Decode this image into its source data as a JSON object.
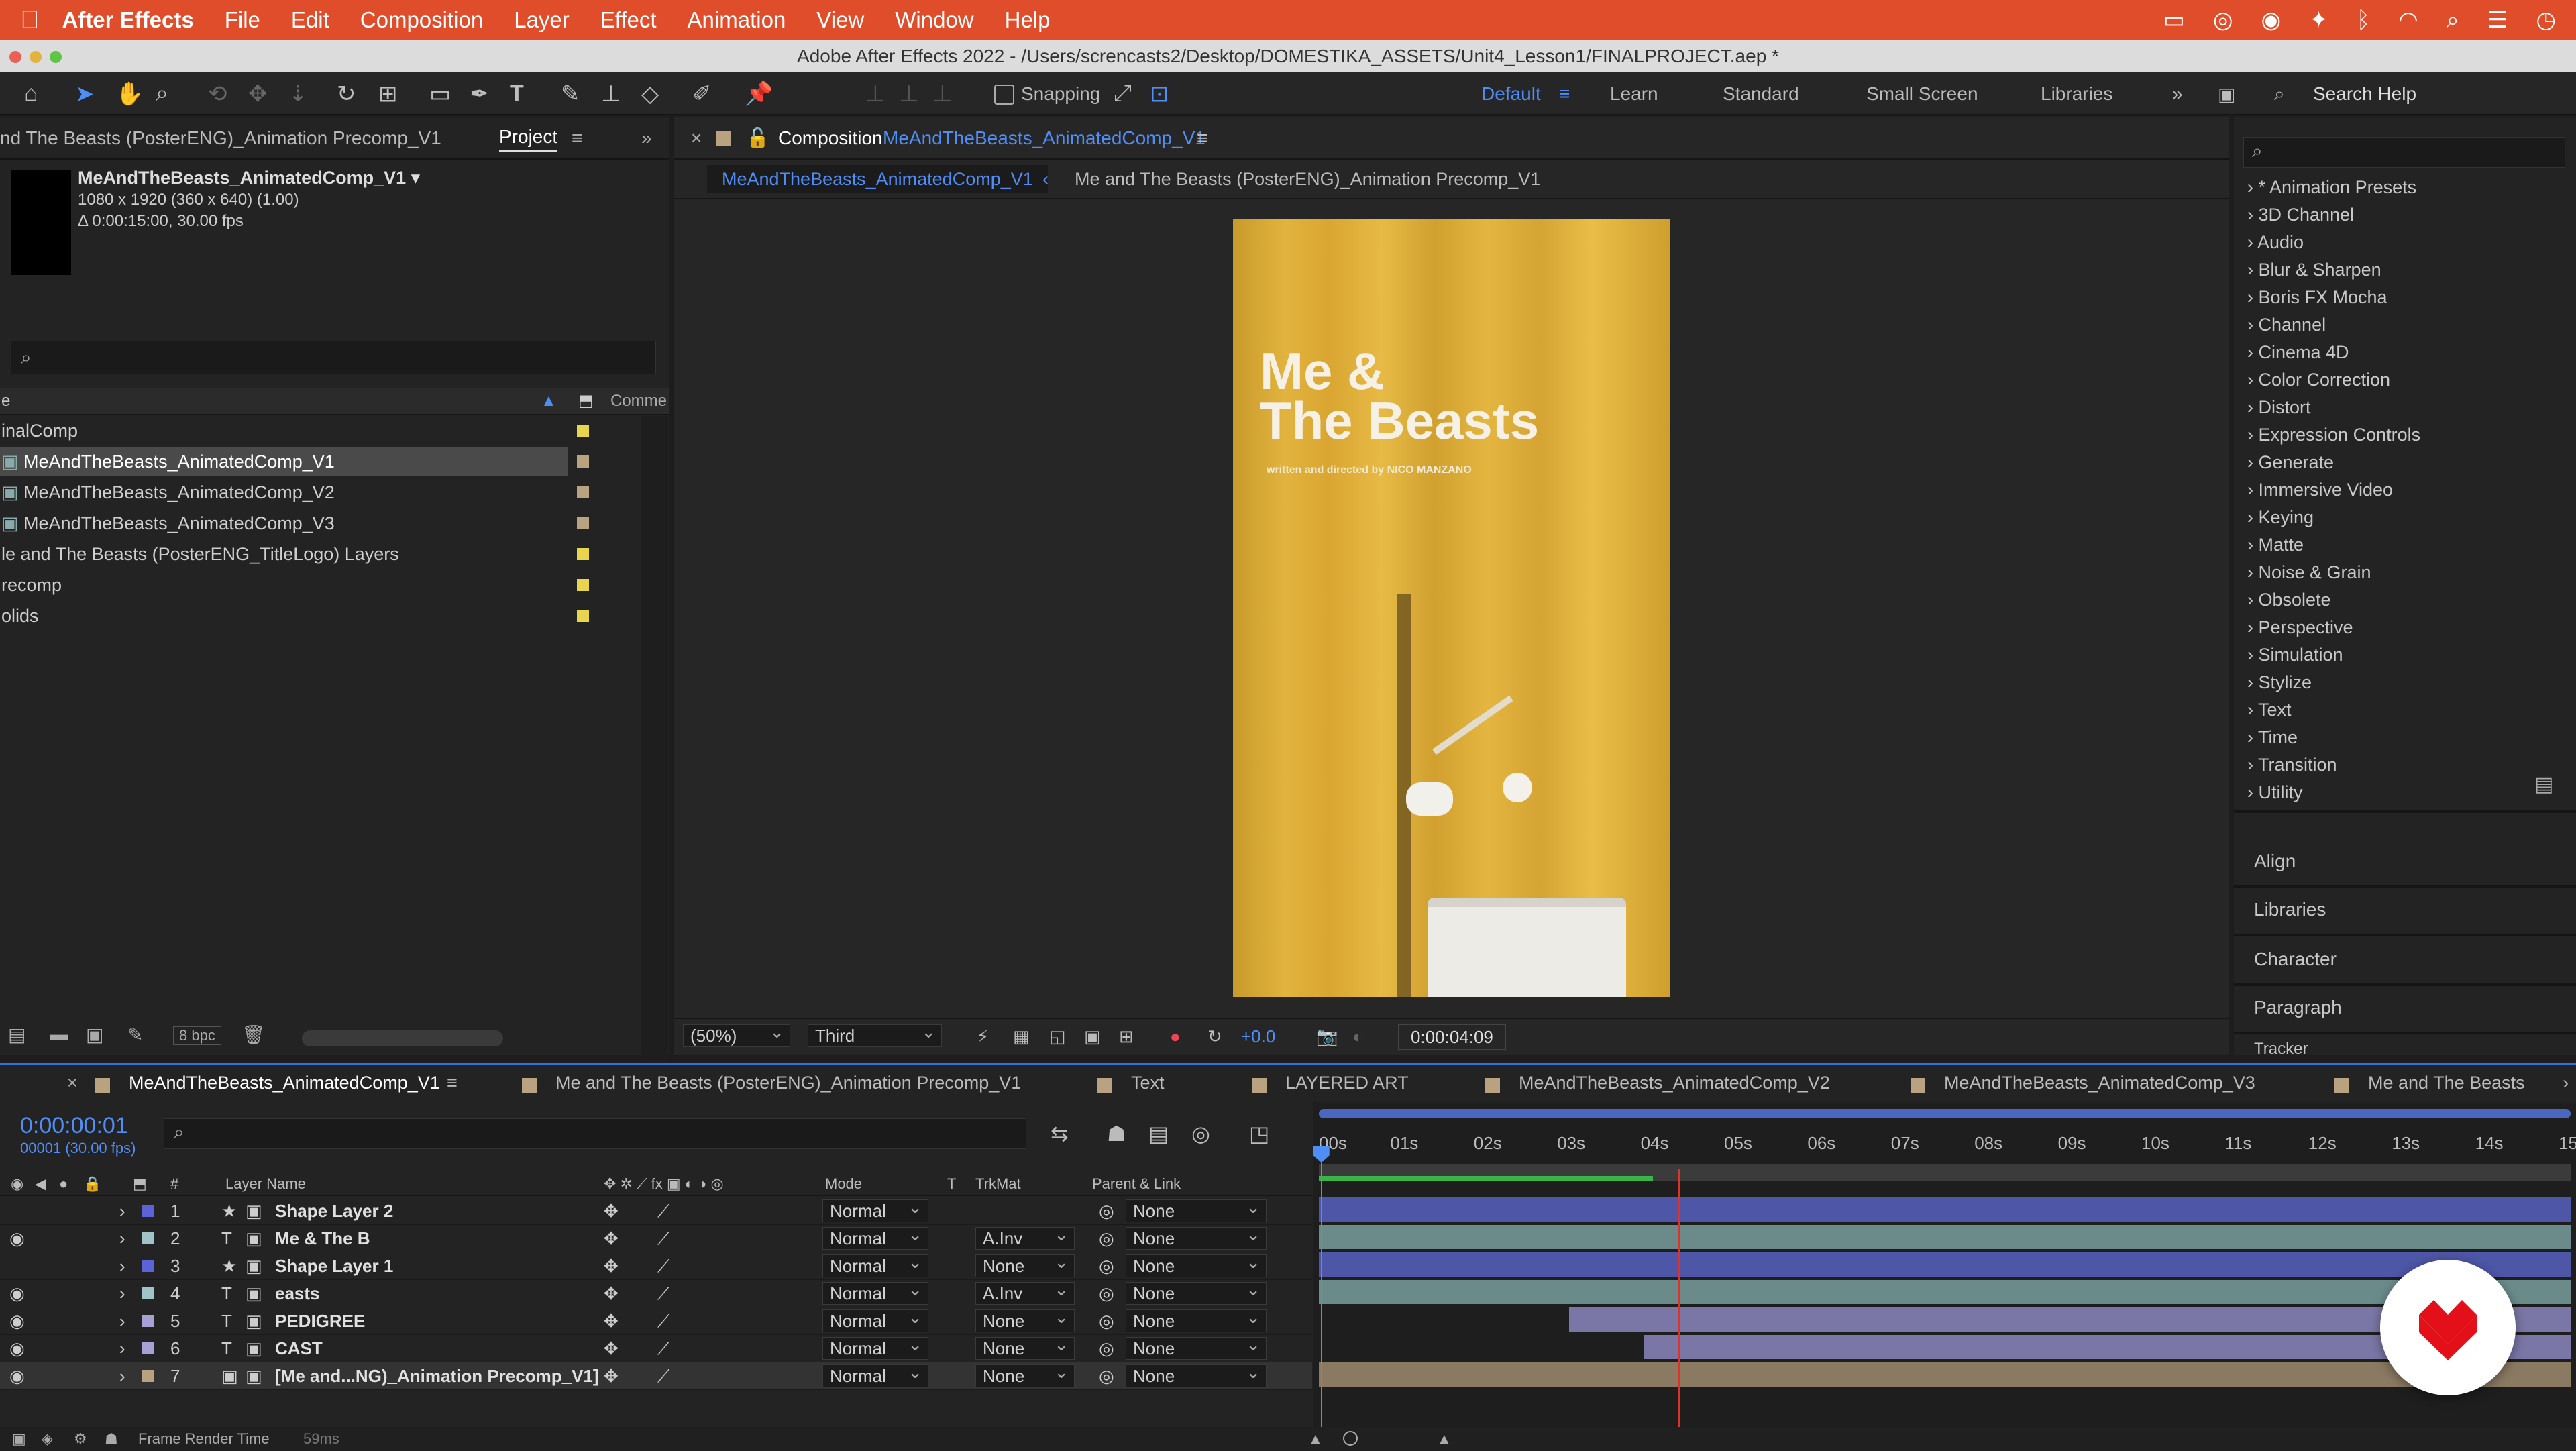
{
  "menubar": {
    "app_name": "After Effects",
    "items": [
      "File",
      "Edit",
      "Composition",
      "Layer",
      "Effect",
      "Animation",
      "View",
      "Window",
      "Help"
    ]
  },
  "window": {
    "title": "Adobe After Effects 2022 - /Users/screncasts2/Desktop/DOMESTIKA_ASSETS/Unit4_Lesson1/FINALPROJECT.aep *"
  },
  "toolbar": {
    "snapping_label": "Snapping",
    "workspaces": [
      "Default",
      "Learn",
      "Standard",
      "Small Screen",
      "Libraries"
    ],
    "active_workspace": "Default",
    "search_help": "Search Help"
  },
  "project": {
    "tab_left": "nd The Beasts (PosterENG)_Animation Precomp_V1",
    "tab_active": "Project",
    "selected_name": "MeAndTheBeasts_AnimatedComp_V1",
    "info_line1": "1080 x 1920  (360 x 640) (1.00)",
    "info_line2": "Δ 0:00:15:00, 30.00 fps",
    "col_name": "e",
    "col_comment": "Comme",
    "items": [
      {
        "label": "inalComp",
        "color": "#e8d44d"
      },
      {
        "label": "MeAndTheBeasts_AnimatedComp_V1",
        "color": "#b9a27f"
      },
      {
        "label": "MeAndTheBeasts_AnimatedComp_V2",
        "color": "#b9a27f"
      },
      {
        "label": "MeAndTheBeasts_AnimatedComp_V3",
        "color": "#b9a27f"
      },
      {
        "label": "le and The Beasts (PosterENG_TitleLogo) Layers",
        "color": "#e8d44d"
      },
      {
        "label": "recomp",
        "color": "#e8d44d"
      },
      {
        "label": "olids",
        "color": "#e8d44d"
      }
    ],
    "bpc": "8 bpc"
  },
  "composition": {
    "panel_label": "Composition",
    "panel_name": "MeAndTheBeasts_AnimatedComp_V1",
    "crumb_active": "MeAndTheBeasts_AnimatedComp_V1",
    "crumb_next": "Me and The Beasts (PosterENG)_Animation Precomp_V1",
    "poster_title_line1": "Me &",
    "poster_title_line2": "The Beasts",
    "poster_credit_prefix": "written and directed by ",
    "poster_credit_name": "NICO MANZANO",
    "zoom": "(50%)",
    "resolution": "Third",
    "exposure": "+0.0",
    "timecode": "0:00:04:09"
  },
  "effects": {
    "items": [
      "* Animation Presets",
      "3D Channel",
      "Audio",
      "Blur & Sharpen",
      "Boris FX Mocha",
      "Channel",
      "Cinema 4D",
      "Color Correction",
      "Distort",
      "Expression Controls",
      "Generate",
      "Immersive Video",
      "Keying",
      "Matte",
      "Noise & Grain",
      "Obsolete",
      "Perspective",
      "Simulation",
      "Stylize",
      "Text",
      "Time",
      "Transition",
      "Utility"
    ],
    "side_panels": [
      "Align",
      "Libraries",
      "Character",
      "Paragraph",
      "Tracker"
    ]
  },
  "timeline": {
    "tabs": [
      {
        "label": "MeAndTheBeasts_AnimatedComp_V1",
        "color": "#b9a27f"
      },
      {
        "label": "Me and The Beasts (PosterENG)_Animation Precomp_V1",
        "color": "#b9a27f"
      },
      {
        "label": "Text",
        "color": "#b9a27f"
      },
      {
        "label": "LAYERED ART",
        "color": "#b9a27f"
      },
      {
        "label": "MeAndTheBeasts_AnimatedComp_V2",
        "color": "#b9a27f"
      },
      {
        "label": "MeAndTheBeasts_AnimatedComp_V3",
        "color": "#b9a27f"
      },
      {
        "label": "Me and The Beasts",
        "color": "#b9a27f"
      }
    ],
    "current_time": "0:00:00:01",
    "frame_info": "00001 (30.00 fps)",
    "headers": {
      "num": "#",
      "layer_name": "Layer Name",
      "mode": "Mode",
      "t": "T",
      "trkmat": "TrkMat",
      "parent": "Parent & Link"
    },
    "ruler": [
      "00s",
      "01s",
      "02s",
      "03s",
      "04s",
      "05s",
      "06s",
      "07s",
      "08s",
      "09s",
      "10s",
      "11s",
      "12s",
      "13s",
      "14s",
      "15s"
    ],
    "playhead_seconds": 0.03,
    "cti_seconds": 4.3,
    "duration_seconds": 15,
    "work_area_end_seconds": 4.0,
    "layers": [
      {
        "num": "1",
        "name": "Shape Layer 2",
        "type": "shape",
        "label_color": "#5b63d6",
        "eye": false,
        "mode": "Normal",
        "trkmat": "",
        "parent": "None",
        "start": 0,
        "bar_color": "#4e56a8"
      },
      {
        "num": "2",
        "name": "Me & The B",
        "type": "text",
        "label_color": "#9fc3c6",
        "eye": true,
        "mode": "Normal",
        "trkmat": "A.Inv",
        "parent": "None",
        "start": 0,
        "bar_color": "#6b8b8b"
      },
      {
        "num": "3",
        "name": "Shape Layer 1",
        "type": "shape",
        "label_color": "#5b63d6",
        "eye": false,
        "mode": "Normal",
        "trkmat": "None",
        "parent": "None",
        "start": 0,
        "bar_color": "#4e56a8"
      },
      {
        "num": "4",
        "name": "easts",
        "type": "text",
        "label_color": "#9fc3c6",
        "eye": true,
        "mode": "Normal",
        "trkmat": "A.Inv",
        "parent": "None",
        "start": 0,
        "bar_color": "#6b8b8b"
      },
      {
        "num": "5",
        "name": "PEDIGREE",
        "type": "text",
        "label_color": "#a7a0d4",
        "eye": true,
        "mode": "Normal",
        "trkmat": "None",
        "parent": "None",
        "start": 3.0,
        "bar_color": "#7a77a6"
      },
      {
        "num": "6",
        "name": "CAST",
        "type": "text",
        "label_color": "#a7a0d4",
        "eye": true,
        "mode": "Normal",
        "trkmat": "None",
        "parent": "None",
        "start": 3.9,
        "bar_color": "#7a77a6"
      },
      {
        "num": "7",
        "name": "[Me and...NG)_Animation Precomp_V1]",
        "type": "comp",
        "label_color": "#b9a27f",
        "eye": true,
        "mode": "Normal",
        "trkmat": "None",
        "parent": "None",
        "start": 0,
        "bar_color": "#8a7a62"
      }
    ],
    "footer_label": "Frame Render Time",
    "footer_value": "59ms"
  }
}
